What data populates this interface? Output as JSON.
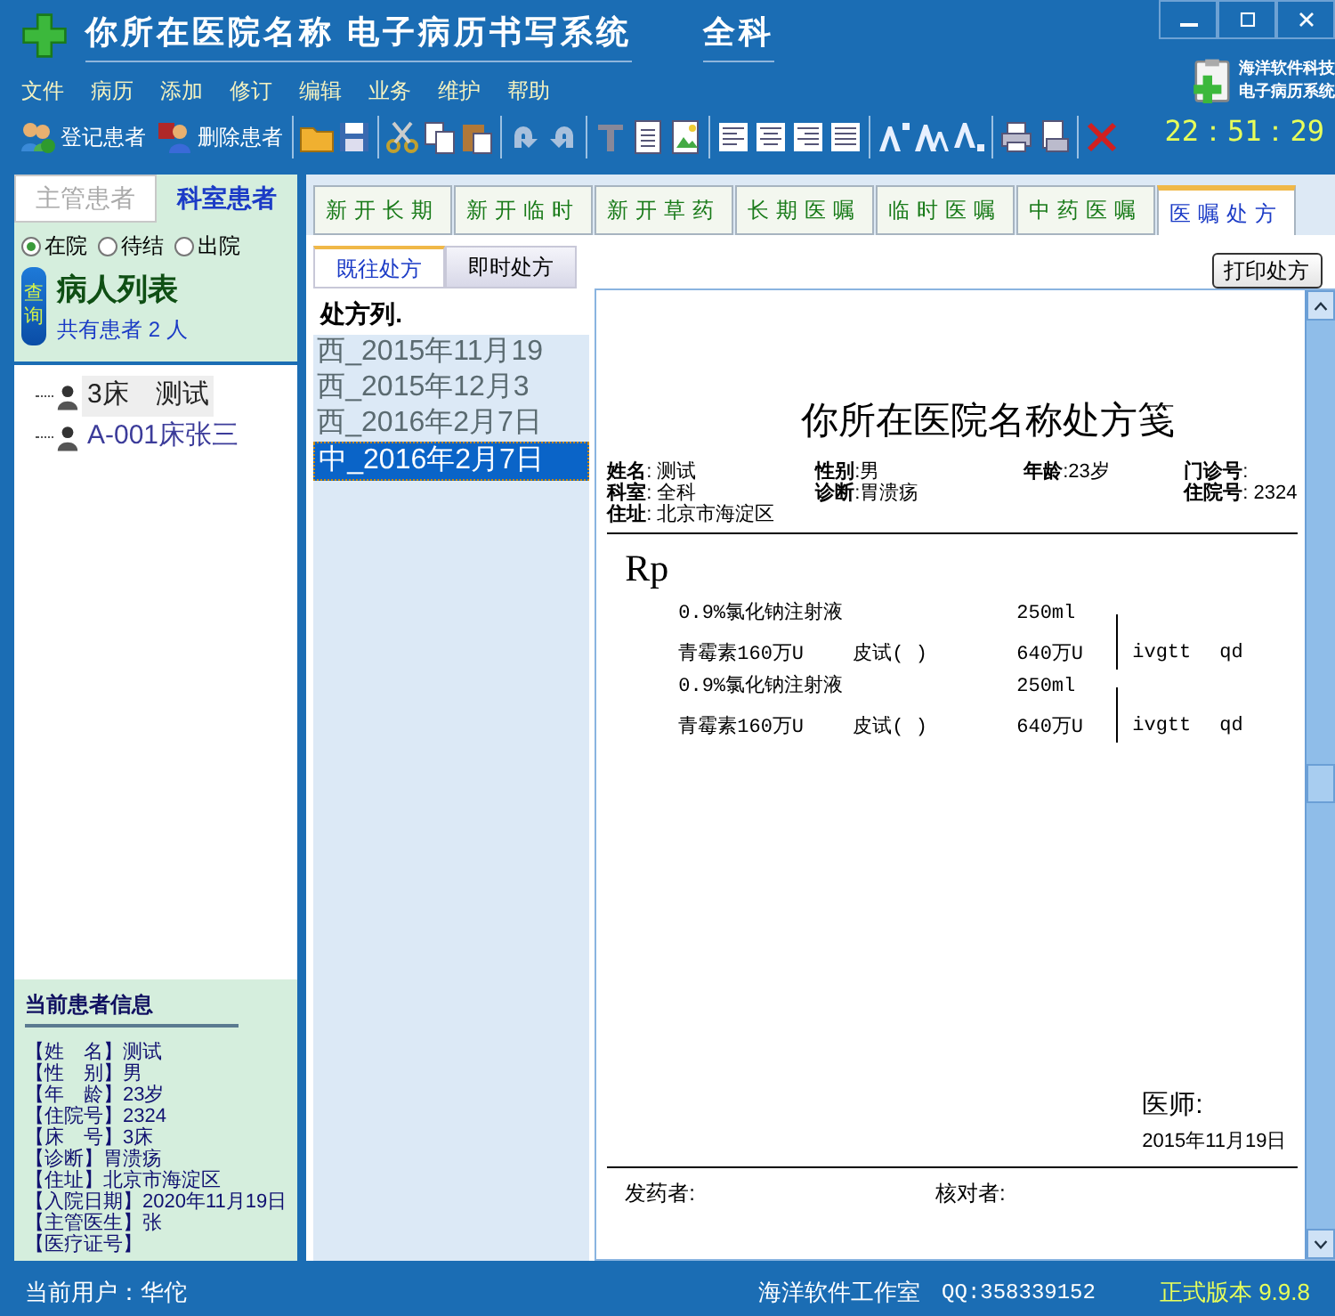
{
  "window": {
    "title": "你所在医院名称 电子病历书写系统",
    "department": "全科"
  },
  "logo": {
    "line_1": "海洋软件科技",
    "line_2": "电子病历系统"
  },
  "clock": "22：51：29",
  "menu": [
    "文件",
    "病历",
    "添加",
    "修订",
    "编辑",
    "业务",
    "维护",
    "帮助"
  ],
  "toolbar_buttons": [
    {
      "label": "登记患者",
      "kind": "add"
    },
    {
      "label": "删除患者",
      "kind": "remove"
    }
  ],
  "patient_tabs": [
    {
      "label": "主管患者",
      "selected": false
    },
    {
      "label": "科室患者",
      "selected": true
    }
  ],
  "status_filter": [
    {
      "label": "在院",
      "selected": true
    },
    {
      "label": "待结",
      "selected": false
    },
    {
      "label": "出院",
      "selected": false
    }
  ],
  "query_button": "查询",
  "list_title": "病人列表",
  "patient_count": "共有患者 2 人",
  "patients": [
    {
      "label": "3床　测试",
      "selected": true
    },
    {
      "label": "A-001床张三",
      "selected": false
    }
  ],
  "current_patient": {
    "title": "当前患者信息",
    "lines": [
      "【姓　名】测试",
      "【性　别】男",
      "【年　龄】23岁",
      "【住院号】2324",
      "【床　号】3床",
      "【诊断】胃溃疡",
      "【住址】北京市海淀区",
      "【入院日期】2020年11月19日",
      "【主管医生】张",
      "【医疗证号】"
    ]
  },
  "order_tabs": [
    {
      "label": "新开长期",
      "selected": false
    },
    {
      "label": "新开临时",
      "selected": false
    },
    {
      "label": "新开草药",
      "selected": false
    },
    {
      "label": "长期医嘱",
      "selected": false
    },
    {
      "label": "临时医嘱",
      "selected": false
    },
    {
      "label": "中药医嘱",
      "selected": false
    },
    {
      "label": "医嘱处方",
      "selected": true
    }
  ],
  "rx_tabs": [
    {
      "label": "既往处方",
      "selected": true
    },
    {
      "label": "即时处方",
      "selected": false
    }
  ],
  "print_button": "打印处方",
  "rx_list": {
    "title": "处方列.",
    "items": [
      {
        "label": "西_2015年11月19",
        "selected": false
      },
      {
        "label": "西_2015年12月3",
        "selected": false
      },
      {
        "label": "西_2016年2月7日",
        "selected": false
      },
      {
        "label": "中_2016年2月7日",
        "selected": true
      }
    ]
  },
  "prescription": {
    "title": "你所在医院名称处方笺",
    "fields": [
      "**姓名**: 测试",
      "**性别**:男",
      "**年龄**:23岁",
      "**门诊号**:",
      "**科室**: 全科",
      "**诊断**:胃溃疡",
      "**住院号**: 2324",
      "**住址**: 北京市海淀区"
    ],
    "rp": "Rp",
    "groups": [
      {
        "items": [
          {
            "name": "0.9%氯化钠注射液",
            "dose": "250ml"
          },
          {
            "name": "青霉素160万U",
            "skin_test": "皮试( )",
            "dose": "640万U"
          }
        ],
        "route": "ivgtt",
        "frequency": "qd"
      },
      {
        "items": [
          {
            "name": "0.9%氯化钠注射液",
            "dose": "250ml"
          },
          {
            "name": "青霉素160万U",
            "skin_test": "皮试( )",
            "dose": "640万U"
          }
        ],
        "route": "ivgtt",
        "frequency": "qd"
      }
    ],
    "doctor": "医师:",
    "date": "2015年11月19日",
    "dispenser": "发药者:",
    "checker": "核对者:"
  },
  "status_bar": {
    "user": "当前用户：华佗",
    "studio": "海洋软件工作室",
    "qq": "QQ:358339152",
    "version": "正式版本 9.9.8"
  }
}
